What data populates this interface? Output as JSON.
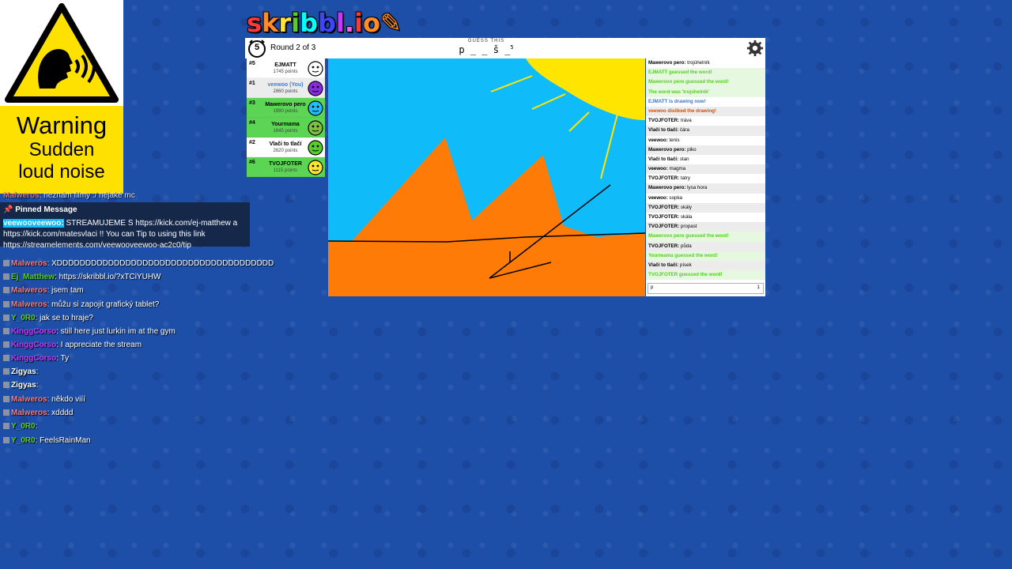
{
  "warning": {
    "title": "Warning",
    "line2": "Sudden",
    "line3": "loud noise"
  },
  "logo": {
    "letters": [
      "s",
      "k",
      "r",
      "i",
      "b",
      "b",
      "l",
      ".",
      "i",
      "o"
    ],
    "colors": [
      "#ff3838",
      "#ff8c26",
      "#ffe52e",
      "#56ce27",
      "#00ffff",
      "#3c46ff",
      "#c638ff",
      "#ff60ec",
      "#ff3838",
      "#ff8c26"
    ]
  },
  "topbar": {
    "timer": "5",
    "round": "Round 2 of 3",
    "guess_label": "GUESS THIS",
    "word_hint": "p _ _ š _",
    "word_len": "5"
  },
  "players": [
    {
      "rank": "#5",
      "name": "EJMATT",
      "points": "1745 points",
      "bg": "white",
      "you": false,
      "avatar_color": "#ffffff"
    },
    {
      "rank": "#1",
      "name": "veewoo (You)",
      "points": "2860 points",
      "bg": "grey",
      "you": true,
      "avatar_color": "#8a2be2"
    },
    {
      "rank": "#3",
      "name": "Mawerovo pero",
      "points": "1990 points",
      "bg": "green",
      "you": false,
      "avatar_color": "#22bdff"
    },
    {
      "rank": "#4",
      "name": "Yourmama",
      "points": "1645 points",
      "bg": "green",
      "you": false,
      "avatar_color": "#7fbf3f"
    },
    {
      "rank": "#2",
      "name": "Vlači to tlačí",
      "points": "2620 points",
      "bg": "white",
      "you": false,
      "avatar_color": "#56ce27"
    },
    {
      "rank": "#6",
      "name": "TVOJFOTER",
      "points": "1115 points",
      "bg": "green",
      "you": false,
      "avatar_color": "#ffe52e"
    }
  ],
  "chat": [
    {
      "user": "Mawerovo pero:",
      "text": "trojúhelník",
      "kind": "msg"
    },
    {
      "user": "",
      "text": "EJMATT guessed the word!",
      "kind": "good"
    },
    {
      "user": "",
      "text": "Mawerovo pero guessed the word!",
      "kind": "good"
    },
    {
      "user": "",
      "text": "The word was 'trojúhelník'",
      "kind": "good"
    },
    {
      "user": "",
      "text": "EJMATT is drawing now!",
      "kind": "draw"
    },
    {
      "user": "",
      "text": "veewoo disliked the drawing!",
      "kind": "bad"
    },
    {
      "user": "TVOJFOTER:",
      "text": "tráva",
      "kind": "msg"
    },
    {
      "user": "Vlači to tlačí:",
      "text": "čára",
      "kind": "msg"
    },
    {
      "user": "veewoo:",
      "text": "tenis",
      "kind": "msg"
    },
    {
      "user": "Mawerovo pero:",
      "text": "piko",
      "kind": "msg"
    },
    {
      "user": "Vlači to tlačí:",
      "text": "stan",
      "kind": "msg"
    },
    {
      "user": "veewoo:",
      "text": "magma",
      "kind": "msg"
    },
    {
      "user": "TVOJFOTER:",
      "text": "tatry",
      "kind": "msg"
    },
    {
      "user": "Mawerovo pero:",
      "text": "lysa hora",
      "kind": "msg"
    },
    {
      "user": "veewoo:",
      "text": "sopka",
      "kind": "msg"
    },
    {
      "user": "TVOJFOTER:",
      "text": "skály",
      "kind": "msg"
    },
    {
      "user": "TVOJFOTER:",
      "text": "skála",
      "kind": "msg"
    },
    {
      "user": "TVOJFOTER:",
      "text": "propast",
      "kind": "msg"
    },
    {
      "user": "",
      "text": "Mawerovo pero guessed the word!",
      "kind": "good"
    },
    {
      "user": "TVOJFOTER:",
      "text": "půda",
      "kind": "msg"
    },
    {
      "user": "",
      "text": "Yourmama guessed the word!",
      "kind": "good"
    },
    {
      "user": "Vlači to tlačí:",
      "text": "písek",
      "kind": "msg"
    },
    {
      "user": "",
      "text": "TVOJFOTER guessed the word!",
      "kind": "good"
    }
  ],
  "chat_input": {
    "value": "p",
    "count": "1"
  },
  "pinned": {
    "header": "Pinned Message",
    "user": "veewooveewoo:",
    "text": "STREAMUJEME S https://kick.com/ej-matthew a https://kick.com/matesvlaci !! You can Tip to",
    "text2": "using this link https://streamelements.com/veewooveewoo-ac2c0/tip"
  },
  "stream_chat": [
    {
      "user": "Malweros",
      "text": ": XDDDDDDDDDDDDDDDDDDDDDDDDDDDDDDDDDDDDDD",
      "color": "#ff7a7a"
    },
    {
      "user": "Ej_Matthew",
      "text": ": https://skribbl.io/?xTCiYUHW",
      "color": "#56ce27"
    },
    {
      "user": "Malweros",
      "text": ": jsem tam",
      "color": "#ff7a7a"
    },
    {
      "user": "Malweros",
      "text": ": můžu si zapojit grafický tablet?",
      "color": "#ff7a7a"
    },
    {
      "user": "Y_0R0",
      "text": ": jak se to hraje?",
      "color": "#56ce27"
    },
    {
      "user": "KinggCorso",
      "text": ": still here just lurkin im at the gym",
      "color": "#c638ff"
    },
    {
      "user": "KinggCorso",
      "text": ": I appreciate the stream",
      "color": "#c638ff"
    },
    {
      "user": "KinggCorso",
      "text": ": Ty",
      "color": "#c638ff"
    },
    {
      "user": "Zigyas",
      "text": ":",
      "color": "#ffffff"
    },
    {
      "user": "Zigyas",
      "text": ":",
      "color": "#ffffff"
    },
    {
      "user": "Malweros",
      "text": ": někdo viíí",
      "color": "#ff7a7a"
    },
    {
      "user": "Malweros",
      "text": ": xdddd",
      "color": "#ff7a7a"
    },
    {
      "user": "Y_0R0",
      "text": ":",
      "color": "#56ce27"
    },
    {
      "user": "Y_0R0",
      "text": ": FeelsRainMan",
      "color": "#56ce27"
    }
  ],
  "stream_chat_top": {
    "user": "Malweros",
    "text": ": neznám filmy :/ nějaké mc",
    "color": "#ff7a7a"
  }
}
